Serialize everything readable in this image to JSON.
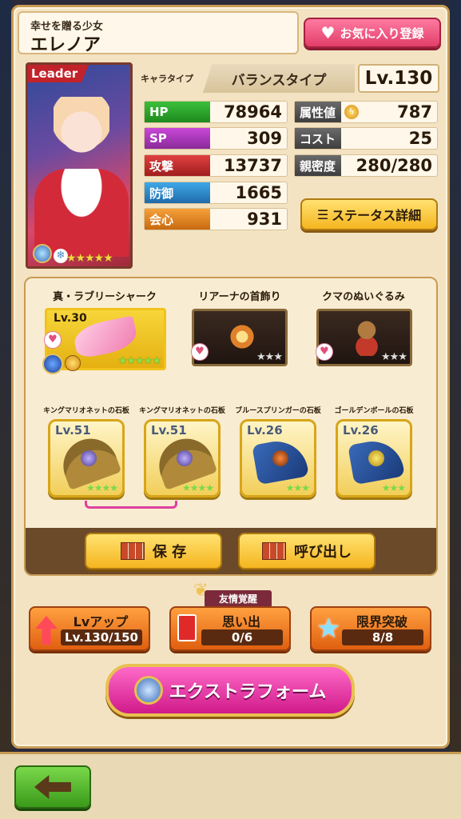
{
  "header": {
    "subtitle": "幸せを贈る少女",
    "name": "エレノア",
    "favorite_label": "お気に入り登録"
  },
  "portrait": {
    "leader_label": "Leader",
    "stars": "★★★★★"
  },
  "char_info": {
    "type_label": "キャラタイプ",
    "type_value": "バランスタイプ",
    "level": "Lv.130"
  },
  "stats": {
    "hp": {
      "label": "HP",
      "value": "78964"
    },
    "sp": {
      "label": "SP",
      "value": "309"
    },
    "atk": {
      "label": "攻撃",
      "value": "13737"
    },
    "def": {
      "label": "防御",
      "value": "1665"
    },
    "crit": {
      "label": "会心",
      "value": "931"
    },
    "attr": {
      "label": "属性値",
      "value": "787"
    },
    "cost": {
      "label": "コスト",
      "value": "25"
    },
    "affinity": {
      "label": "親密度",
      "value": "280/280"
    }
  },
  "status_detail_label": "ステータス詳細",
  "equipment": [
    {
      "title": "真・ラブリーシャーク",
      "level": "Lv.30",
      "stars": "★★★★★"
    },
    {
      "title": "リアーナの首飾り",
      "level": "",
      "stars": "★★★"
    },
    {
      "title": "クマのぬいぐるみ",
      "level": "",
      "stars": "★★★"
    }
  ],
  "stones": [
    {
      "title": "キングマリオネットの石板",
      "level": "Lv.51",
      "stars": "★★★★"
    },
    {
      "title": "キングマリオネットの石板",
      "level": "Lv.51",
      "stars": "★★★★"
    },
    {
      "title": "ブルースプリンガーの石板",
      "level": "Lv.26",
      "stars": "★★★"
    },
    {
      "title": "ゴールデンボールの石板",
      "level": "Lv.26",
      "stars": "★★★"
    }
  ],
  "actions": {
    "save_label": "保 存",
    "load_label": "呼び出し"
  },
  "bottom_actions": {
    "lvup": {
      "title": "Lvアップ",
      "value": "Lv.130/150"
    },
    "memory": {
      "tag": "友情覚醒",
      "title": "思い出",
      "value": "0/6"
    },
    "limit": {
      "title": "限界突破",
      "value": "8/8"
    }
  },
  "extra_form_label": "エクストラフォーム",
  "colors": {
    "panel": "#f3e3c2",
    "accent_pink": "#e13f6a",
    "button_yellow": "#f5b520",
    "button_orange": "#e06010",
    "back_green": "#3a9a1a"
  }
}
